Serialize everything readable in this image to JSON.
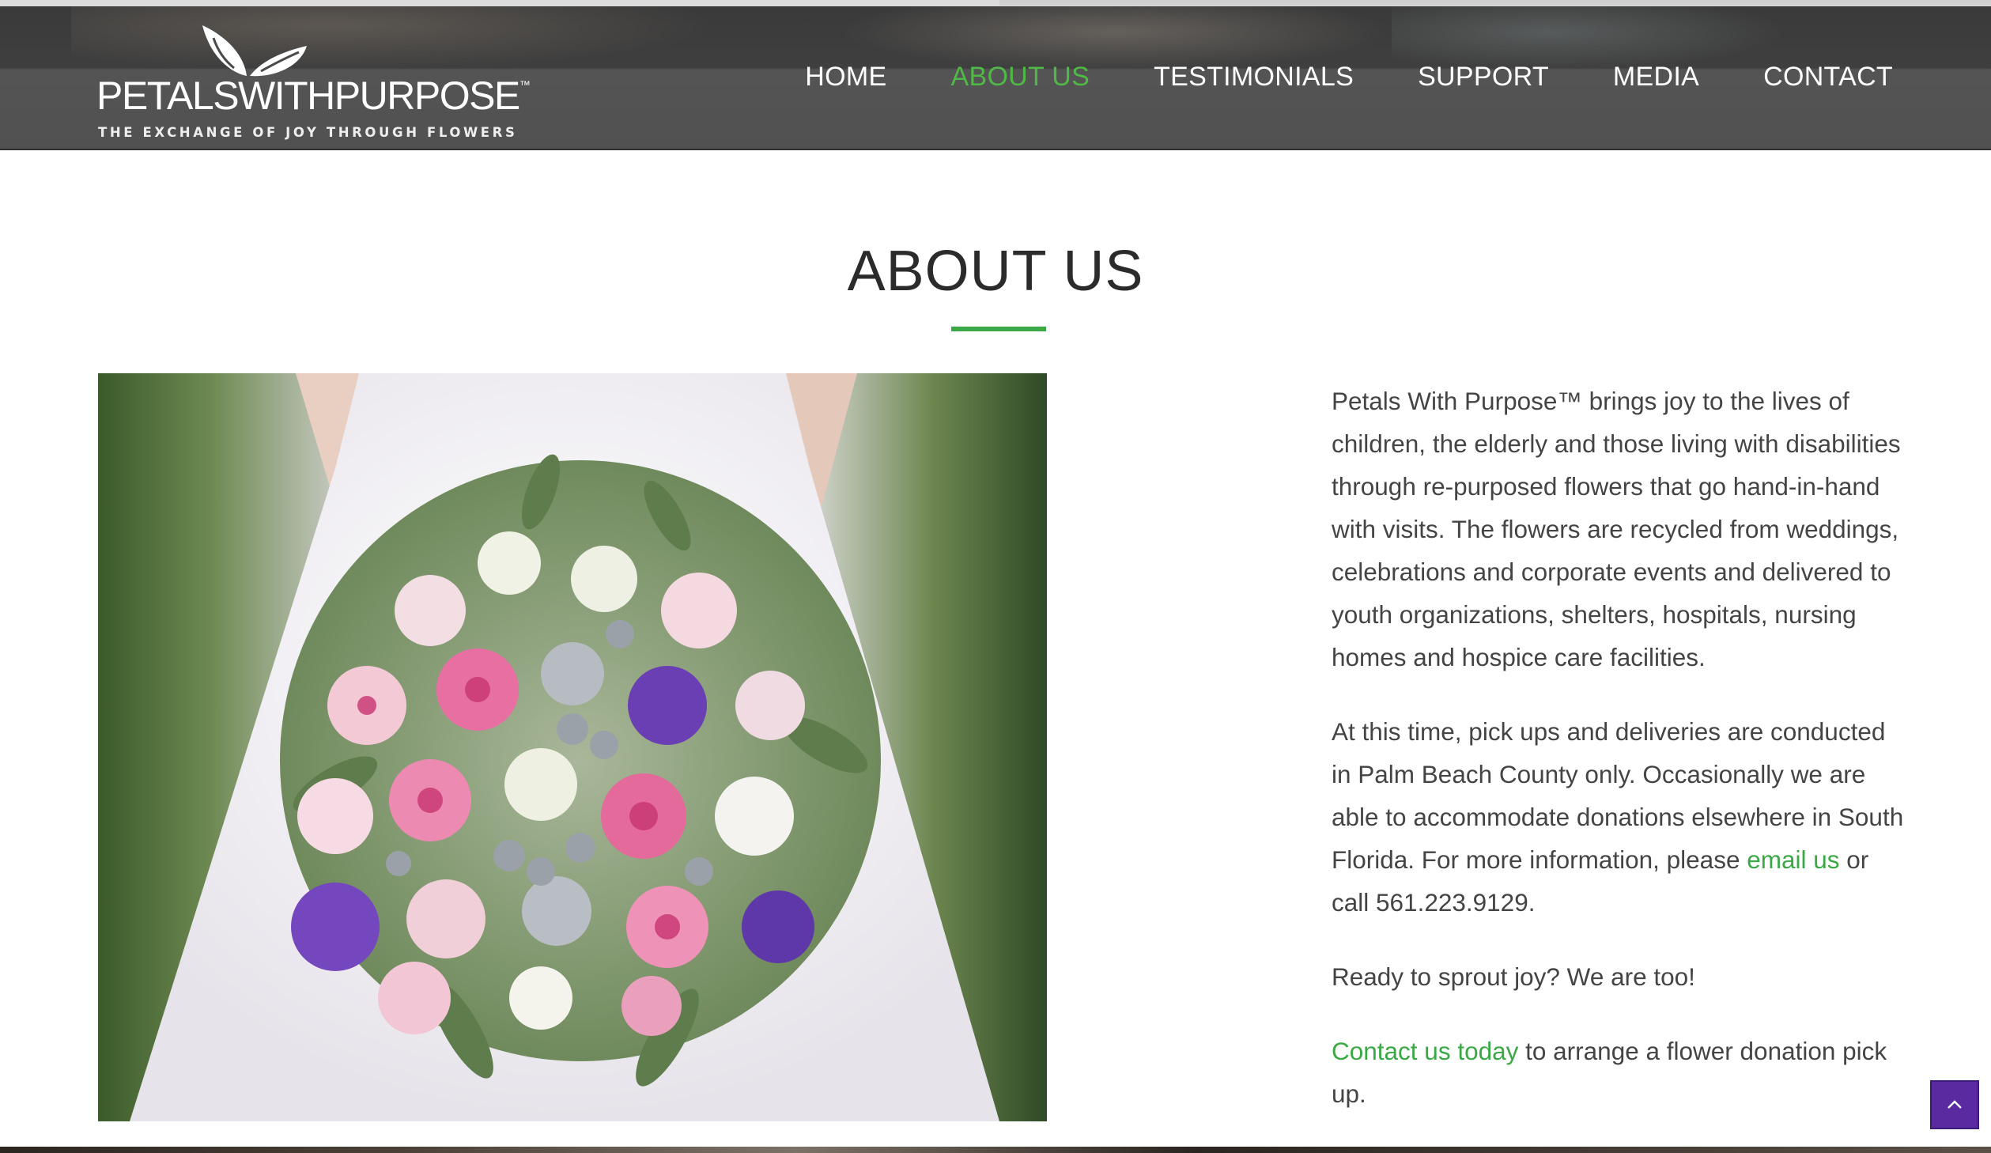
{
  "brand": {
    "name": "PETALSWITHPURPOSE",
    "trademark": "™",
    "tagline": "THE EXCHANGE OF JOY THROUGH FLOWERS"
  },
  "nav": {
    "items": [
      {
        "label": "HOME"
      },
      {
        "label": "ABOUT US",
        "active": true
      },
      {
        "label": "TESTIMONIALS"
      },
      {
        "label": "SUPPORT"
      },
      {
        "label": "MEDIA"
      },
      {
        "label": "CONTACT"
      }
    ],
    "active_color": "#4fb846"
  },
  "page": {
    "title": "ABOUT US",
    "accent_color": "#3aa845"
  },
  "image": {
    "subject": "bride holding a bouquet of pink and white roses, purple lisianthus and silver brunia"
  },
  "content": {
    "paragraph1": "Petals With Purpose™ brings joy to the lives of children, the elderly and those living with disabilities through re-purposed flowers that go hand-in-hand with visits. The flowers are recycled from weddings, celebrations and corporate events and delivered to youth organizations, shelters, hospitals, nursing homes and hospice care facilities.",
    "paragraph2_before": "At this time, pick ups and deliveries are conducted in Palm Beach County only. Occasionally we are able to accommodate donations elsewhere in South Florida. For more information, please ",
    "paragraph2_link": "email us",
    "paragraph2_after": " or call 561.223.9129.",
    "paragraph3": "Ready to sprout joy? We are too!",
    "paragraph4_link": "Contact us today",
    "paragraph4_after": " to arrange a flower donation pick up."
  },
  "back_to_top": {
    "icon": "chevron-up-icon",
    "color": "#5a2aa0"
  }
}
